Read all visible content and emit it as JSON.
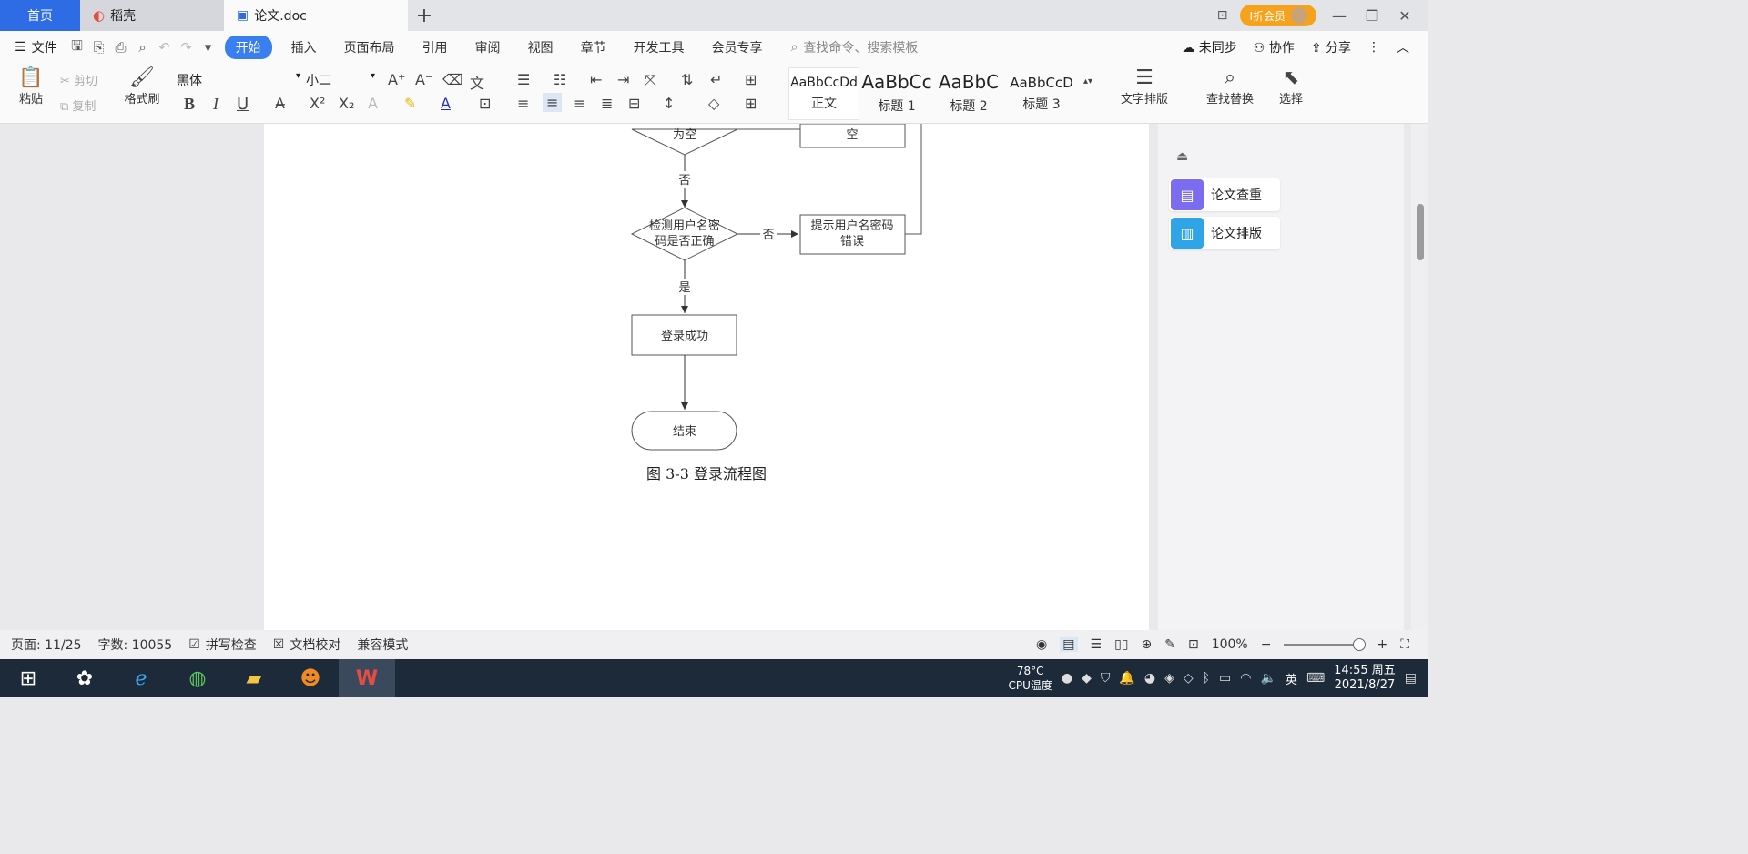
{
  "tabs": {
    "home": "首页",
    "daoke": "稻壳",
    "doc": "论文.doc",
    "add": "+"
  },
  "title_right": {
    "vip": "Ⅰ折会员",
    "minimize": "—",
    "restore": "❐",
    "close": "✕"
  },
  "menu": {
    "file": "文件",
    "items": [
      "开始",
      "插入",
      "页面布局",
      "引用",
      "审阅",
      "视图",
      "章节",
      "开发工具",
      "会员专享"
    ],
    "active": "开始",
    "search": "查找命令、搜索模板",
    "sync": "未同步",
    "collab": "协作",
    "share": "分享"
  },
  "ribbon": {
    "paste": "粘贴",
    "cut": "剪切",
    "copy": "复制",
    "format_painter": "格式刷",
    "font": "黑体",
    "size": "小二",
    "bold": "B",
    "italic": "I",
    "underline": "U",
    "superscript": "X²",
    "subscript": "X₂",
    "styles": [
      {
        "sample": "AaBbCcDd",
        "name": "正文"
      },
      {
        "sample": "AaBbCc",
        "name": "标题 1"
      },
      {
        "sample": "AaBbC",
        "name": "标题 2"
      },
      {
        "sample": "AaBbCcD",
        "name": "标题 3"
      }
    ],
    "text_layout": "文字排版",
    "find_replace": "查找替换",
    "select": "选择"
  },
  "flowchart": {
    "diamond1_partial": "为空",
    "box1_partial": "空",
    "no1": "否",
    "diamond2_line1": "检测用户名密",
    "diamond2_line2": "码是否正确",
    "no2": "否",
    "box2_line1": "提示用户名密码",
    "box2_line2": "错误",
    "yes": "是",
    "success": "登录成功",
    "end": "结束",
    "caption": "图 3-3 登录流程图"
  },
  "side_panel": {
    "check": "论文查重",
    "layout": "论文排版"
  },
  "status": {
    "page": "页面: 11/25",
    "words": "字数: 10055",
    "spell": "拼写检查",
    "proof": "文档校对",
    "compat": "兼容模式",
    "zoom": "100%"
  },
  "taskbar": {
    "temp": "78°C",
    "cpu": "CPU温度",
    "ime": "英",
    "time": "14:55 周五",
    "date": "2021/8/27"
  },
  "colors": {
    "accent": "#3a7ff0",
    "home_tab": "#2e6ce6",
    "vip": "#f6a21d",
    "taskbar": "#1c2a3a",
    "check_icon": "#7c6cf0",
    "layout_icon": "#2fa4e7"
  }
}
